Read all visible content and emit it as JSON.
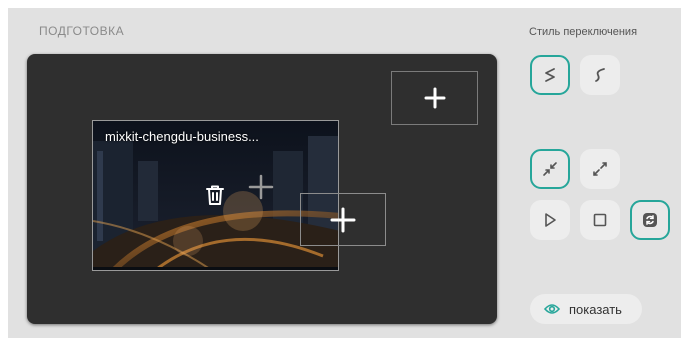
{
  "section": {
    "title": "ПОДГОТОВКА"
  },
  "stage": {
    "media": {
      "title": "mixkit-chengdu-business..."
    }
  },
  "controls": {
    "switch_style_label": "Стиль переключения",
    "show_label": "показать"
  },
  "icons": {
    "add": "plus-icon",
    "delete": "trash-icon",
    "style_1": "curve-s-icon",
    "style_2": "curve-s-alt-icon",
    "shrink": "shrink-icon",
    "expand": "expand-icon",
    "play": "play-icon",
    "stop": "stop-icon",
    "swap": "swap-icon",
    "show": "eye-icon"
  },
  "colors": {
    "accent": "#26a69a",
    "stage_bg": "#2f2f2f",
    "panel_bg": "#e1e1e1"
  }
}
